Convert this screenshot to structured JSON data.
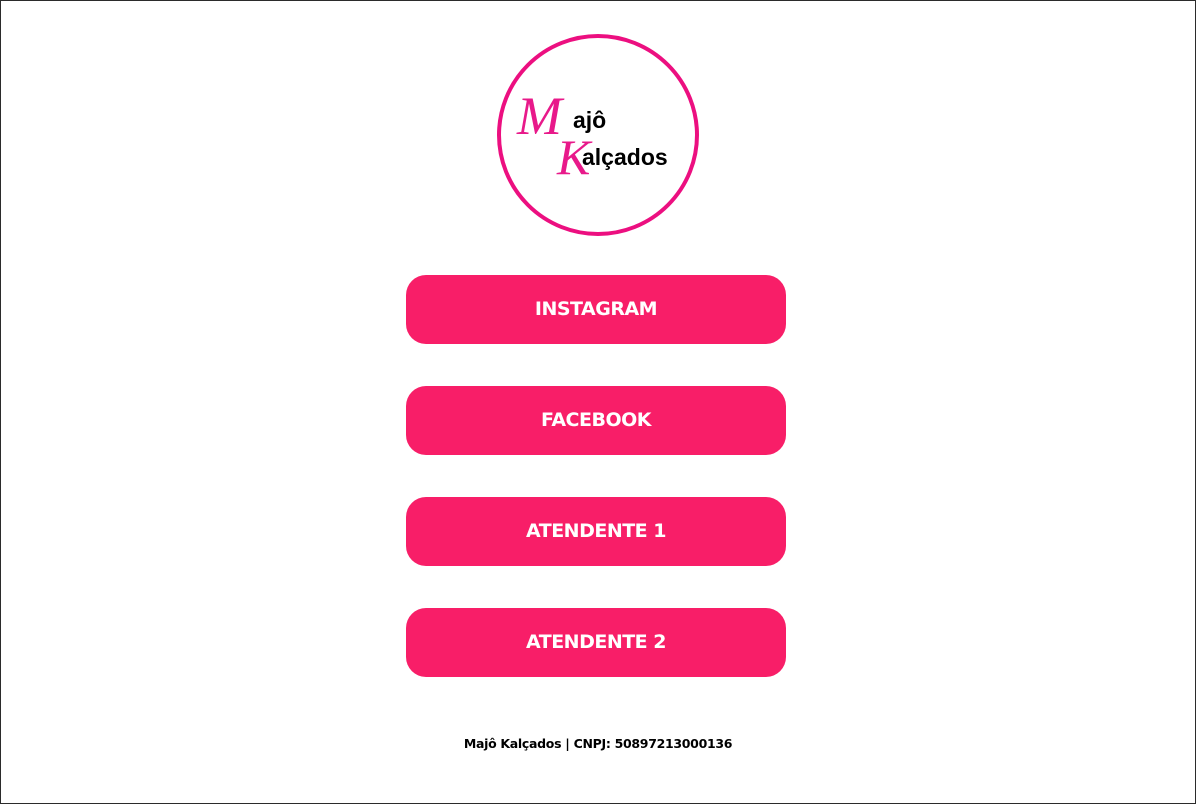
{
  "logo": {
    "initial_1": "M",
    "word_1": "ajô",
    "initial_2": "K",
    "word_2": "alçados",
    "ring_color": "#ec0f80",
    "initial_color": "#e8198a"
  },
  "buttons": [
    {
      "label": "INSTAGRAM"
    },
    {
      "label": "FACEBOOK"
    },
    {
      "label": "ATENDENTE 1"
    },
    {
      "label": "ATENDENTE 2"
    }
  ],
  "button_color": "#f81e68",
  "footer": {
    "text": "Majô Kalçados | CNPJ: 50897213000136"
  }
}
